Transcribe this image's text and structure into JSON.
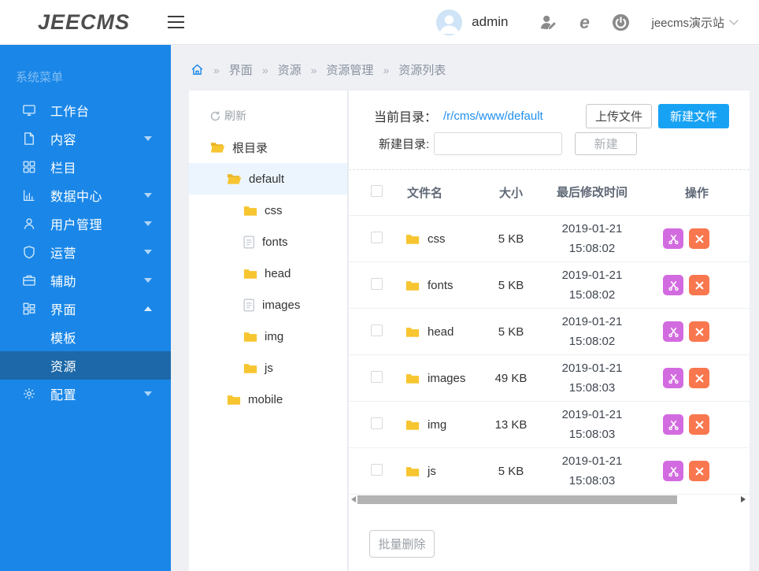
{
  "header": {
    "logo": "JEECMS",
    "user_name": "admin",
    "site_selector": "jeecms演示站"
  },
  "sidebar": {
    "title": "系统菜单",
    "items": [
      {
        "label": "工作台",
        "icon": "monitor-icon",
        "expandable": false
      },
      {
        "label": "内容",
        "icon": "document-icon",
        "expandable": true
      },
      {
        "label": "栏目",
        "icon": "grid-icon",
        "expandable": false
      },
      {
        "label": "数据中心",
        "icon": "chart-icon",
        "expandable": true
      },
      {
        "label": "用户管理",
        "icon": "user-icon",
        "expandable": true
      },
      {
        "label": "运营",
        "icon": "shield-icon",
        "expandable": true
      },
      {
        "label": "辅助",
        "icon": "briefcase-icon",
        "expandable": true
      },
      {
        "label": "界面",
        "icon": "layout-icon",
        "expandable": true,
        "expanded": true,
        "children": [
          {
            "label": "模板",
            "active": false
          },
          {
            "label": "资源",
            "active": true
          }
        ]
      },
      {
        "label": "配置",
        "icon": "gear-icon",
        "expandable": true
      }
    ]
  },
  "breadcrumb": {
    "separator": "»",
    "items": [
      "界面",
      "资源",
      "资源管理",
      "资源列表"
    ]
  },
  "tree": {
    "refresh_label": "刷新",
    "nodes": [
      {
        "label": "根目录",
        "icon": "folder-open-icon",
        "level": 0,
        "selected": false
      },
      {
        "label": "default",
        "icon": "folder-open-icon",
        "level": 1,
        "selected": true
      },
      {
        "label": "css",
        "icon": "folder-icon",
        "level": 2,
        "selected": false
      },
      {
        "label": "fonts",
        "icon": "file-icon",
        "level": 2,
        "selected": false
      },
      {
        "label": "head",
        "icon": "folder-icon",
        "level": 2,
        "selected": false
      },
      {
        "label": "images",
        "icon": "file-icon",
        "level": 2,
        "selected": false
      },
      {
        "label": "img",
        "icon": "folder-icon",
        "level": 2,
        "selected": false
      },
      {
        "label": "js",
        "icon": "folder-icon",
        "level": 2,
        "selected": false
      },
      {
        "label": "mobile",
        "icon": "folder-icon",
        "level": 1,
        "selected": false
      }
    ]
  },
  "toolbar": {
    "current_dir_label": "当前目录：",
    "current_dir_path": "/r/cms/www/default",
    "upload_button": "上传文件",
    "new_file_button": "新建文件",
    "new_dir_label": "新建目录:",
    "new_dir_value": "",
    "create_button": "新建"
  },
  "table": {
    "columns": {
      "name": "文件名",
      "size": "大小",
      "modified": "最后修改时间",
      "actions": "操作"
    },
    "rows": [
      {
        "name": "css",
        "size": "5 KB",
        "modified": "2019-01-21 15:08:02"
      },
      {
        "name": "fonts",
        "size": "5 KB",
        "modified": "2019-01-21 15:08:02"
      },
      {
        "name": "head",
        "size": "5 KB",
        "modified": "2019-01-21 15:08:02"
      },
      {
        "name": "images",
        "size": "49 KB",
        "modified": "2019-01-21 15:08:03"
      },
      {
        "name": "img",
        "size": "13 KB",
        "modified": "2019-01-21 15:08:03"
      },
      {
        "name": "js",
        "size": "5 KB",
        "modified": "2019-01-21 15:08:03"
      }
    ],
    "batch_delete_button": "批量删除"
  },
  "colors": {
    "sidebar_blue": "#1a87e8",
    "sidebar_active_blue": "#1c68a8",
    "primary_button_blue": "#18a2f4",
    "link_blue": "#2090f0",
    "folder_yellow": "#f7c530",
    "cut_action_purple": "#d36be0",
    "delete_action_orange": "#f8774f"
  }
}
